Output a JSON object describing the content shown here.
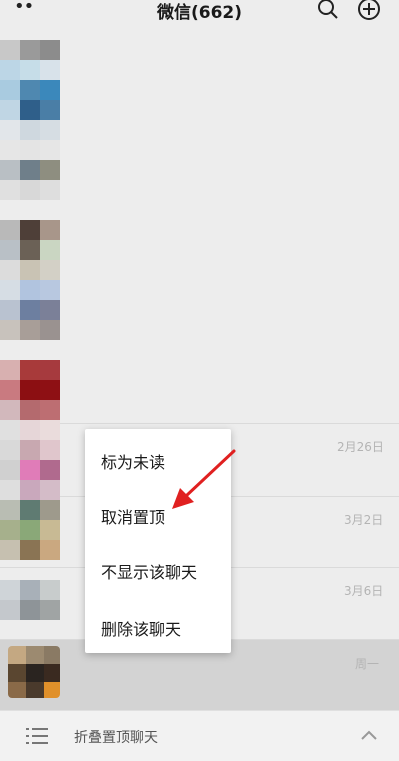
{
  "header": {
    "title": "微信(662)",
    "more_icon": "more-dots-icon",
    "search_icon": "search-icon",
    "add_icon": "plus-circle-icon"
  },
  "chats": [
    {
      "time": "2月26日"
    },
    {
      "time": "3月2日"
    },
    {
      "time": "3月6日"
    },
    {
      "time": "周一"
    }
  ],
  "context_menu": {
    "items": [
      "标为未读",
      "取消置顶",
      "不显示该聊天",
      "删除该聊天"
    ]
  },
  "bottom_bar": {
    "label": "折叠置顶聊天",
    "list_icon": "list-icon",
    "chevron_icon": "chevron-up-icon"
  },
  "colors": {
    "background": "#ededed",
    "arrow": "#e02020"
  }
}
